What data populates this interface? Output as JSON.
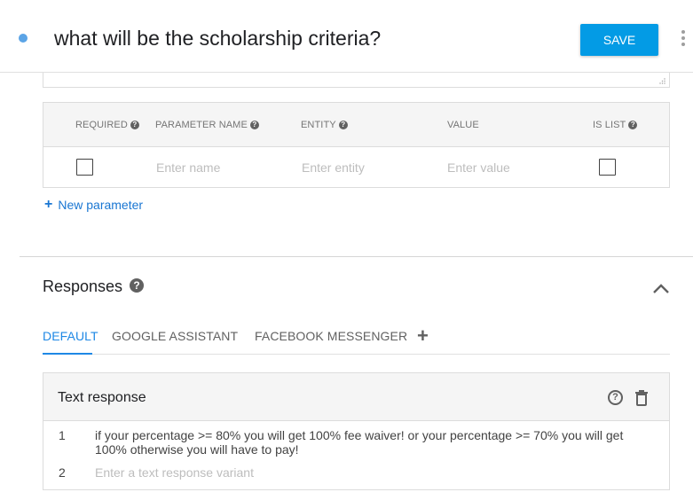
{
  "header": {
    "title": "what will be the scholarship criteria?",
    "save_label": "SAVE",
    "accent_color": "#039be5"
  },
  "parameters": {
    "columns": {
      "required": "REQUIRED",
      "name": "PARAMETER NAME",
      "entity": "ENTITY",
      "value": "VALUE",
      "is_list": "IS LIST"
    },
    "row": {
      "name_placeholder": "Enter name",
      "entity_placeholder": "Enter entity",
      "value_placeholder": "Enter value",
      "required_checked": false,
      "is_list_checked": false
    },
    "new_parameter_label": "New parameter"
  },
  "responses": {
    "title": "Responses",
    "tabs": [
      "DEFAULT",
      "GOOGLE ASSISTANT",
      "FACEBOOK MESSENGER"
    ],
    "active_tab": "DEFAULT",
    "card": {
      "title": "Text response",
      "lines": [
        {
          "num": "1",
          "text": "if your percentage >= 80% you will get 100% fee waiver! or your percentage >= 70% you will get 100% otherwise you will have to pay!"
        },
        {
          "num": "2",
          "placeholder": "Enter a text response variant"
        }
      ]
    }
  },
  "icons": {
    "status_dot": "status-dot-icon",
    "kebab": "more-vert-icon",
    "help": "help-icon",
    "collapse": "chevron-up-icon",
    "add_tab": "plus-icon",
    "delete": "trash-icon"
  }
}
